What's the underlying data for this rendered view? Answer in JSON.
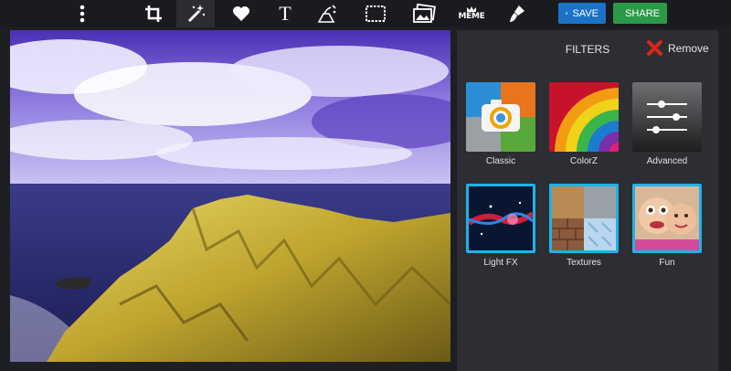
{
  "toolbar": {
    "tools": [
      {
        "name": "more",
        "icon": "vertical-dots-icon"
      },
      {
        "name": "crop",
        "icon": "crop-icon"
      },
      {
        "name": "filters",
        "icon": "magic-wand-icon",
        "active": true
      },
      {
        "name": "stickers",
        "icon": "heart-icon"
      },
      {
        "name": "text",
        "icon": "text-icon",
        "label": "T"
      },
      {
        "name": "draw",
        "icon": "paint-drip-icon"
      },
      {
        "name": "frames",
        "icon": "frame-icon"
      },
      {
        "name": "overlays",
        "icon": "photos-icon"
      },
      {
        "name": "meme",
        "icon": "meme-icon",
        "label": "MEME"
      },
      {
        "name": "brush",
        "icon": "brush-icon"
      }
    ],
    "save_label": "SAVE",
    "share_label": "SHARE",
    "save_color": "#1a73c8",
    "share_color": "#2a9a46"
  },
  "panel": {
    "title": "FILTERS",
    "remove_label": "Remove",
    "remove_icon": "close-x-icon",
    "filters": [
      {
        "label": "Classic",
        "selected": false
      },
      {
        "label": "ColorZ",
        "selected": false
      },
      {
        "label": "Advanced",
        "selected": false
      },
      {
        "label": "Light FX",
        "selected": true
      },
      {
        "label": "Textures",
        "selected": true
      },
      {
        "label": "Fun",
        "selected": true
      }
    ],
    "accent": "#1fb2e8"
  }
}
